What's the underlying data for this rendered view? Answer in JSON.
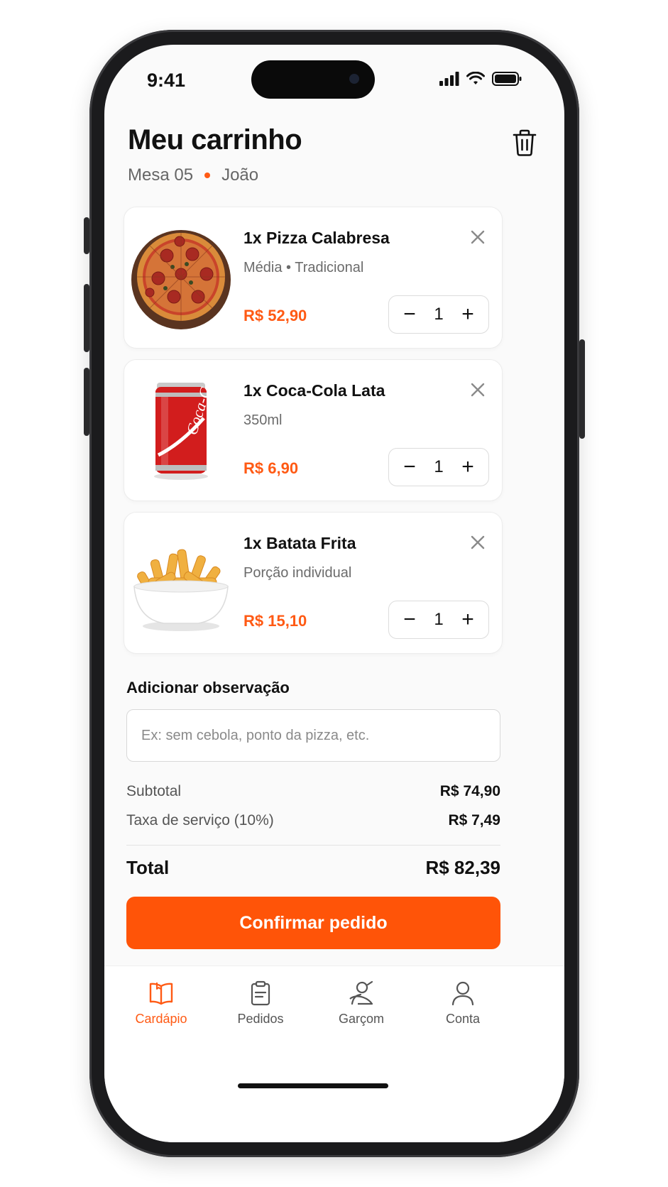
{
  "status": {
    "time": "9:41"
  },
  "header": {
    "title": "Meu carrinho",
    "table": "Mesa 05",
    "customer": "João"
  },
  "cart": {
    "items": [
      {
        "name": "1x Pizza Calabresa",
        "description": "Média • Tradicional",
        "price": "R$ 52,90",
        "quantity": "1"
      },
      {
        "name": "1x Coca-Cola Lata",
        "description": "350ml",
        "price": "R$ 6,90",
        "quantity": "1"
      },
      {
        "name": "1x Batata Frita",
        "description": "Porção individual",
        "price": "R$ 15,10",
        "quantity": "1"
      }
    ]
  },
  "stepper": {
    "minus": "−",
    "plus": "+"
  },
  "observation": {
    "label": "Adicionar observação",
    "placeholder": "Ex: sem cebola, ponto da pizza, etc.",
    "value": ""
  },
  "summary": {
    "subtotal_label": "Subtotal",
    "subtotal_value": "R$ 74,90",
    "fee_label": "Taxa de serviço (10%)",
    "fee_value": "R$ 7,49",
    "total_label": "Total",
    "total_value": "R$ 82,39"
  },
  "confirm_label": "Confirmar pedido",
  "tabs": [
    {
      "label": "Cardápio",
      "icon": "menu-book-icon",
      "active": true
    },
    {
      "label": "Pedidos",
      "icon": "clipboard-icon",
      "active": false
    },
    {
      "label": "Garçom",
      "icon": "waiter-icon",
      "active": false
    },
    {
      "label": "Conta",
      "icon": "user-icon",
      "active": false
    }
  ],
  "colors": {
    "accent": "#ff5a14",
    "button": "#ff5408"
  }
}
